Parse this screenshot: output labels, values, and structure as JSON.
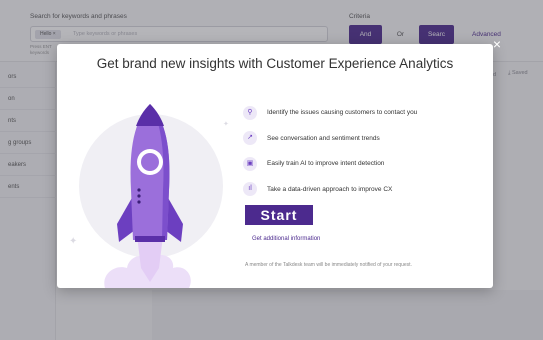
{
  "topbar": {
    "search_label": "Search for keywords and phrases",
    "chip": "Hello",
    "chip_close": "×",
    "search_placeholder": "Type keywords or phrases",
    "hint": "Press ENT keywords",
    "criteria_label": "Criteria",
    "and_label": "And",
    "or_label": "Or",
    "search_label_btn": "Searc",
    "advanced_label": "Advanced"
  },
  "sidebar": {
    "items": [
      "ors",
      "on",
      "nts",
      "g groups",
      "eakers",
      "ents"
    ]
  },
  "right": {
    "partial": "d",
    "save": "Saved"
  },
  "modal": {
    "title": "Get brand new insights with Customer Experience Analytics",
    "close": "×",
    "features": [
      {
        "icon": "search-icon",
        "glyph": "⚲",
        "text": "Identify the issues causing customers to contact you"
      },
      {
        "icon": "trend-icon",
        "glyph": "↗",
        "text": "See conversation and sentiment trends"
      },
      {
        "icon": "ai-chip-icon",
        "glyph": "▣",
        "text": "Easily train AI to improve intent detection"
      },
      {
        "icon": "bar-chart-icon",
        "glyph": "ıl",
        "text": "Take a data-driven approach to improve CX"
      }
    ],
    "start_label": "Start",
    "info_link": "Get additional information",
    "notice": "A member of the Talkdesk team will be immediately notified of your request."
  },
  "colors": {
    "accent": "#4c2a8e",
    "rocket_body": "#9b6fdb",
    "rocket_dark": "#6c3fc0",
    "flame": "#e8d8f7"
  }
}
